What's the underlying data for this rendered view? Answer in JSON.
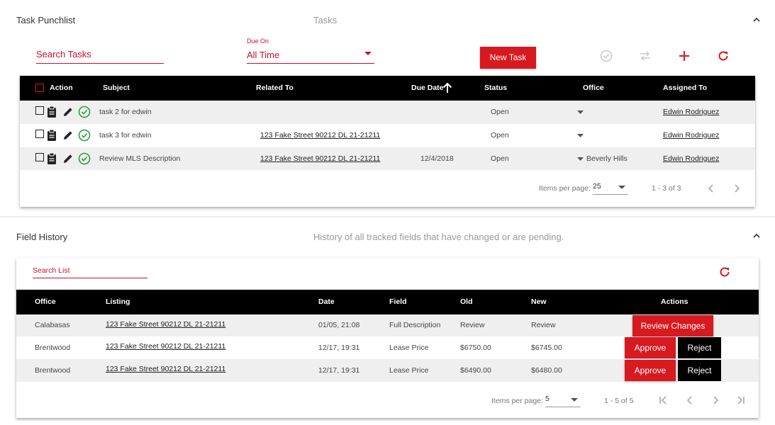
{
  "tasks_panel": {
    "title": "Task Punchlist",
    "subtitle": "Tasks",
    "search_placeholder": "Search Tasks",
    "due_on_label": "Due On",
    "due_on_value": "All Time",
    "new_task_label": "New Task",
    "columns": {
      "action": "Action",
      "subject": "Subject",
      "related_to": "Related To",
      "due_date": "Due Date",
      "status": "Status",
      "office": "Office",
      "assigned_to": "Assigned To"
    },
    "rows": [
      {
        "subject": "task 2 for edwin",
        "related_to": "",
        "due_date": "",
        "status": "Open",
        "office": "",
        "assigned_to": "Edwin Rodriguez"
      },
      {
        "subject": "task 3 for edwin",
        "related_to": "123 Fake Street 90212 DL 21-21211",
        "due_date": "",
        "status": "Open",
        "office": "",
        "assigned_to": "Edwin Rodriguez"
      },
      {
        "subject": "Review MLS Description",
        "related_to": "123 Fake Street 90212 DL 21-21211",
        "due_date": "12/4/2018",
        "status": "Open",
        "office": "Beverly Hills",
        "assigned_to": "Edwin Rodriguez"
      }
    ],
    "pager": {
      "items_per_page_label": "Items per page:",
      "items_per_page": "25",
      "range": "1 - 3 of 3"
    }
  },
  "history_panel": {
    "title": "Field History",
    "subtitle": "History of all tracked fields that have changed or are pending.",
    "search_placeholder": "Search List",
    "columns": {
      "office": "Office",
      "listing": "Listing",
      "date": "Date",
      "field": "Field",
      "old": "Old",
      "new": "New",
      "actions": "Actions"
    },
    "rows": [
      {
        "office": "Calabasas",
        "listing": "123 Fake Street 90212 DL 21-21211",
        "date": "01/05, 21:08",
        "field": "Full Description",
        "old": "Review",
        "new": "Review",
        "action": "Review Changes"
      },
      {
        "office": "Brentwood",
        "listing": "123 Fake Street 90212 DL 21-21211",
        "date": "12/17, 19:31",
        "field": "Lease Price",
        "old": "$6750.00",
        "new": "$6745.00",
        "approve": "Approve",
        "reject": "Reject"
      },
      {
        "office": "Brentwood",
        "listing": "123 Fake Street 90212 DL 21-21211",
        "date": "12/17, 19:31",
        "field": "Lease Price",
        "old": "$6490.00",
        "new": "$6480.00",
        "approve": "Approve",
        "reject": "Reject"
      }
    ],
    "pager": {
      "items_per_page_label": "Items per page:",
      "items_per_page": "5",
      "range": "1 - 5 of 5"
    }
  },
  "colors": {
    "accent": "#d71920",
    "header": "#000000",
    "check_green": "#2e9e3e"
  }
}
